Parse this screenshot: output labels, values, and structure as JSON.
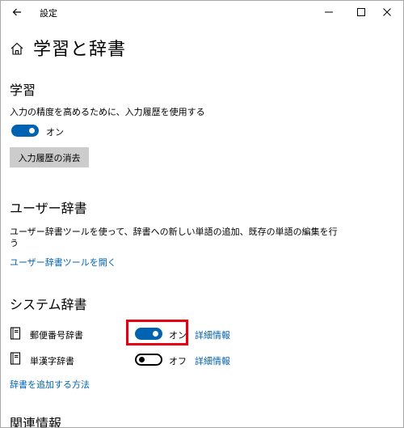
{
  "window": {
    "app_title": "設定",
    "back_icon": "back-arrow-icon",
    "minimize_icon": "minimize-icon",
    "maximize_icon": "maximize-icon",
    "close_icon": "close-icon"
  },
  "header": {
    "home_icon": "home-icon",
    "title": "学習と辞書"
  },
  "learning": {
    "title": "学習",
    "description": "入力の精度を高めるために、入力履歴を使用する",
    "toggle_state": "on",
    "toggle_label": "オン",
    "clear_button": "入力履歴の消去"
  },
  "user_dictionary": {
    "title": "ユーザー辞書",
    "description_line1": "ユーザー辞書ツールを使って、辞書への新しい単語の追加、既存の単語の編集を行",
    "description_line2": "う",
    "link": "ユーザー辞書ツールを開く"
  },
  "system_dictionary": {
    "title": "システム辞書",
    "items": [
      {
        "label": "郵便番号辞書",
        "toggle_state": "on",
        "toggle_label": "オン",
        "detail_link": "詳細情報",
        "icon": "dictionary-icon"
      },
      {
        "label": "単漢字辞書",
        "toggle_state": "off",
        "toggle_label": "オフ",
        "detail_link": "詳細情報",
        "icon": "dictionary-icon"
      }
    ],
    "add_link": "辞書を追加する方法"
  },
  "related": {
    "title": "関連情報"
  },
  "colors": {
    "accent": "#0063b1",
    "highlight": "#e60012",
    "button_bg": "#cccccc"
  }
}
